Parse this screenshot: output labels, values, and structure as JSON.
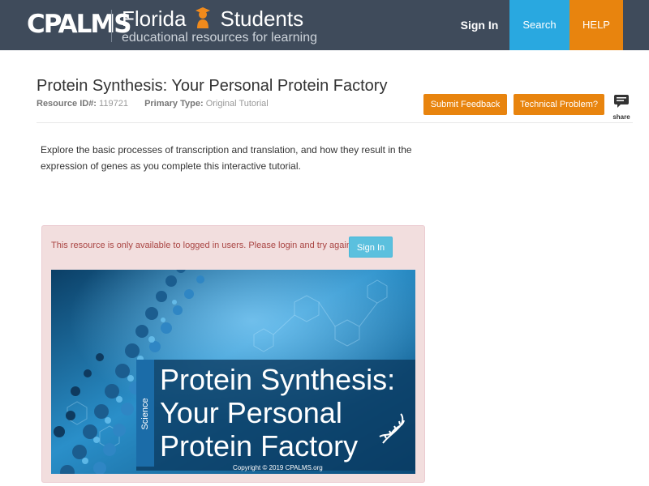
{
  "header": {
    "logo_text": "CPALMS",
    "brand_main_left": "Florida",
    "brand_main_right": "Students",
    "brand_sub": "educational resources for learning",
    "nav": {
      "signin": "Sign In",
      "search": "Search",
      "help": "HELP"
    },
    "colors": {
      "bar": "#3f4b5b",
      "search": "#29a8e0",
      "help": "#e8840e"
    }
  },
  "resource": {
    "title": "Protein Synthesis: Your Personal Protein Factory",
    "id_label": "Resource ID#:",
    "id_value": "119721",
    "type_label": "Primary Type:",
    "type_value": "Original Tutorial",
    "buttons": {
      "feedback": "Submit Feedback",
      "technical": "Technical Problem?",
      "share": "share"
    },
    "description": "Explore the basic processes of transcription and translation, and how they result in the expression of genes as you complete this interactive tutorial."
  },
  "login_notice": {
    "message": "This resource is only available to logged in users. Please login and try again.",
    "signin_button": "Sign In"
  },
  "banner": {
    "subject": "Science",
    "title_line1": "Protein Synthesis:",
    "title_line2": "Your Personal",
    "title_line3": "Protein Factory",
    "copyright": "Copyright © 2019 CPALMS.org",
    "icon": "dna-icon"
  }
}
